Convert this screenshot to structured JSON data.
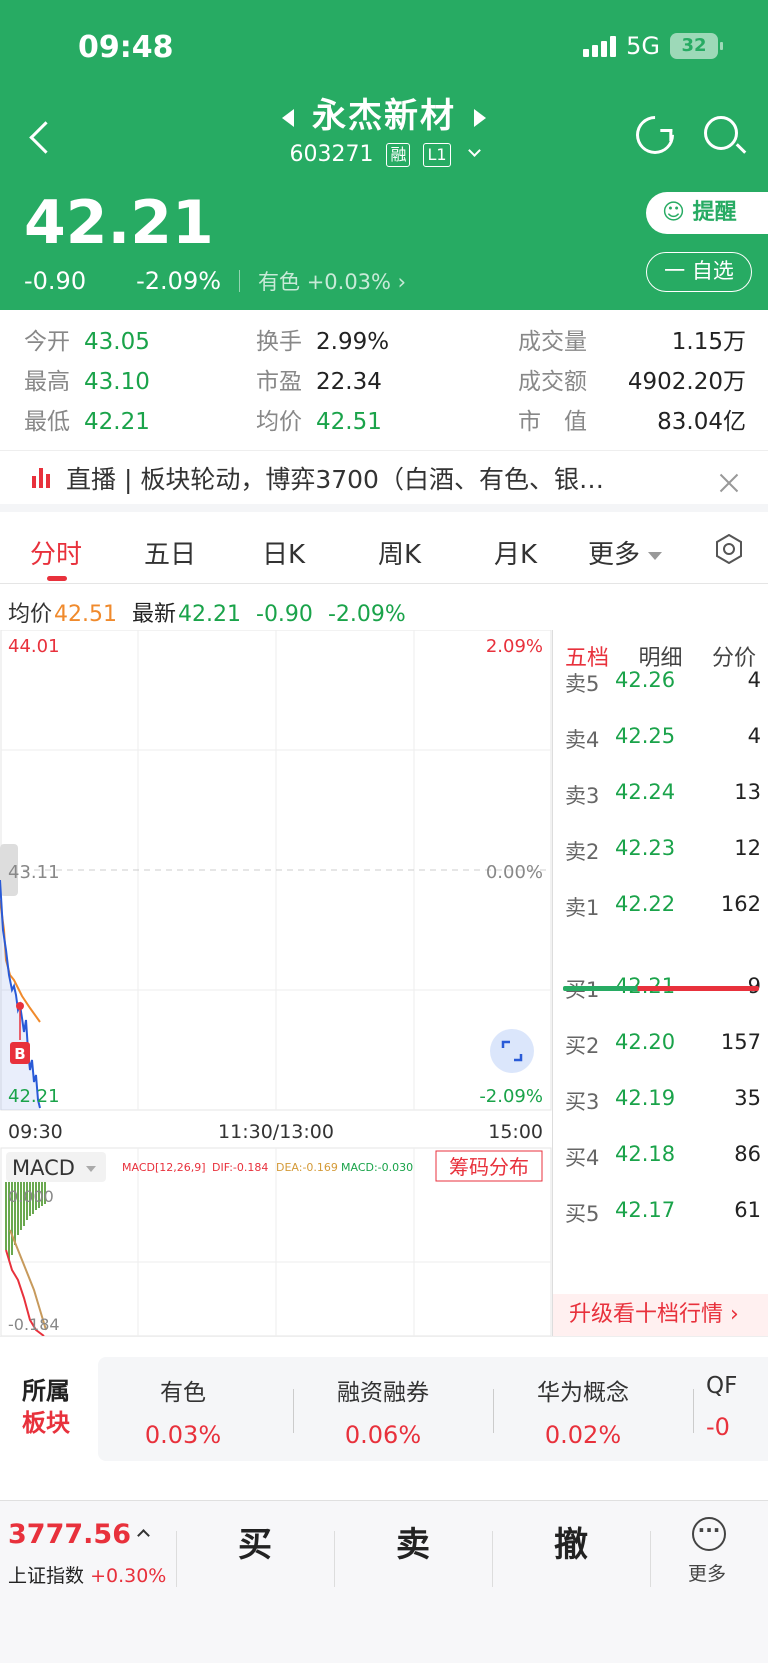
{
  "status": {
    "time": "09:48",
    "network": "5G",
    "battery": "32"
  },
  "header": {
    "name": "永杰新材",
    "code": "603271",
    "tag1": "融",
    "tag2": "L1",
    "price": "42.21",
    "change": "-0.90",
    "change_pct": "-2.09%",
    "sector_link": "有色 +0.03%",
    "alert_label": "提醒",
    "watch_label": "一 自选"
  },
  "stats": {
    "open_label": "今开",
    "open": "43.05",
    "high_label": "最高",
    "high": "43.10",
    "low_label": "最低",
    "low": "42.21",
    "turnover_label": "换手",
    "turnover": "2.99%",
    "pe_label": "市盈",
    "pe": "22.34",
    "avg_label": "均价",
    "avg": "42.51",
    "volume_label": "成交量",
    "volume": "1.15万",
    "amount_label": "成交额",
    "amount": "4902.20万",
    "mcap_label": "市　值",
    "mcap": "83.04亿"
  },
  "live": {
    "text": "直播 | 板块轮动，博弈3700（白酒、有色、银…"
  },
  "tabs": [
    "分时",
    "五日",
    "日K",
    "周K",
    "月K",
    "更多"
  ],
  "inforow": {
    "avg_label": "均价",
    "avg": "42.51",
    "last_label": "最新",
    "last": "42.21",
    "chg": "-0.90",
    "pct": "-2.09%"
  },
  "chart": {
    "high_price": "44.01",
    "high_pct": "2.09%",
    "mid_price": "43.11",
    "mid_pct": "0.00%",
    "low_price": "42.21",
    "low_pct": "-2.09%",
    "time_start": "09:30",
    "time_mid": "11:30/13:00",
    "time_end": "15:00",
    "marker": "B",
    "macd_label": "MACD",
    "macd_params": "MACD[12,26,9]",
    "dif": "DIF:-0.184",
    "dea": "DEA:-0.169",
    "macd_val": "MACD:-0.030",
    "chip_btn": "筹码分布",
    "macd_top": "0.000",
    "macd_bottom": "-0.184"
  },
  "book": {
    "tabs": [
      "五档",
      "明细",
      "分价"
    ],
    "asks": [
      {
        "label": "卖5",
        "price": "42.26",
        "vol": "4"
      },
      {
        "label": "卖4",
        "price": "42.25",
        "vol": "4"
      },
      {
        "label": "卖3",
        "price": "42.24",
        "vol": "13"
      },
      {
        "label": "卖2",
        "price": "42.23",
        "vol": "12"
      },
      {
        "label": "卖1",
        "price": "42.22",
        "vol": "162"
      }
    ],
    "bids": [
      {
        "label": "买1",
        "price": "42.21",
        "vol": "9"
      },
      {
        "label": "买2",
        "price": "42.20",
        "vol": "157"
      },
      {
        "label": "买3",
        "price": "42.19",
        "vol": "35"
      },
      {
        "label": "买4",
        "price": "42.18",
        "vol": "86"
      },
      {
        "label": "买5",
        "price": "42.17",
        "vol": "61"
      }
    ],
    "upgrade": "升级看十档行情 ›"
  },
  "sectors": {
    "title1": "所属",
    "title2": "板块",
    "items": [
      {
        "name": "有色",
        "pct": "0.03%"
      },
      {
        "name": "融资融券",
        "pct": "0.06%"
      },
      {
        "name": "华为概念",
        "pct": "0.02%"
      },
      {
        "name": "QF",
        "pct": "-0"
      }
    ]
  },
  "bottom": {
    "index_value": "3777.56",
    "index_name": "上证指数",
    "index_pct": "+0.30%",
    "buy": "买",
    "sell": "卖",
    "cancel": "撤",
    "more": "更多"
  },
  "colors": {
    "brand": "#27ab63",
    "up": "#e8313c",
    "down": "#1aa34a"
  }
}
